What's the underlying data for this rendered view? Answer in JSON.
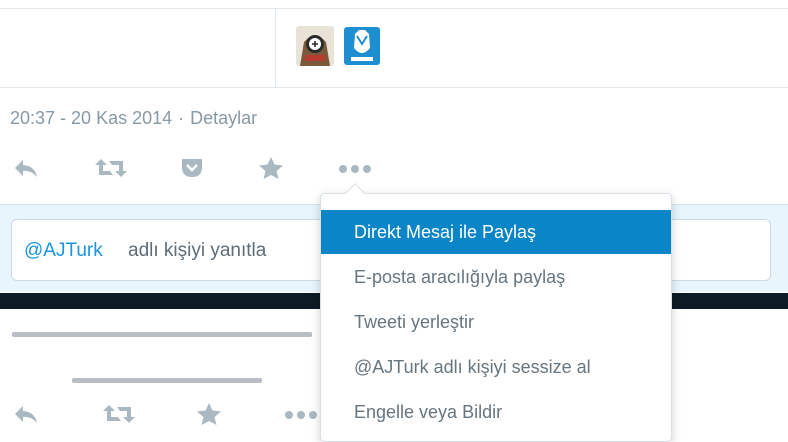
{
  "tweet": {
    "timestamp": "20:37 - 20 Kas 2014",
    "separator": "·",
    "details_link": "Detaylar"
  },
  "actions": {
    "reply_icon": "reply-icon",
    "retweet_icon": "retweet-icon",
    "pocket_icon": "pocket-icon",
    "favorite_icon": "star-icon",
    "more_icon": "more-dots-icon"
  },
  "reply": {
    "mention": "@AJTurk",
    "label": "adlı kişiyi yanıtla"
  },
  "menu": {
    "items": [
      {
        "label": "Direkt Mesaj ile Paylaş",
        "active": true
      },
      {
        "label": "E-posta aracılığıyla paylaş",
        "active": false
      },
      {
        "label": "Tweeti yerleştir",
        "active": false
      },
      {
        "label": "@AJTurk adlı kişiyi sessize al",
        "active": false
      },
      {
        "label": "Engelle veya Bildir",
        "active": false
      }
    ]
  },
  "colors": {
    "accent": "#0a85c7",
    "icon": "#aab8c2",
    "mention": "#1b95e0"
  }
}
